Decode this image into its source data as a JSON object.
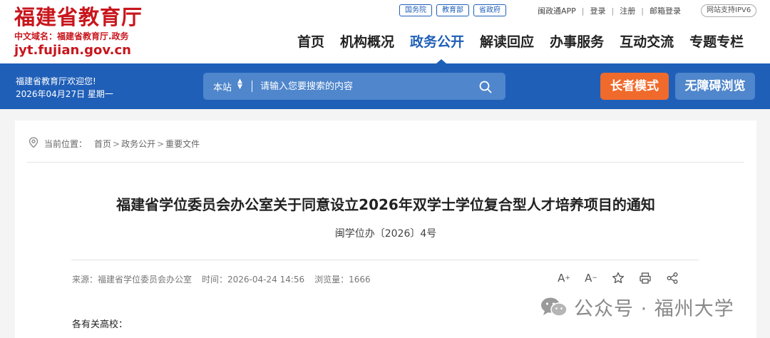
{
  "header": {
    "logo_title": "福建省教育厅",
    "logo_domain": "中文域名：福建省教育厅.政务",
    "logo_url": "jyt.fujian.gov.cn",
    "gov_links": [
      "国务院",
      "教育部",
      "省政府"
    ],
    "util_links": [
      "闽政通APP",
      "登录",
      "注册",
      "邮箱登录"
    ],
    "ipv6": "网站支持IPV6",
    "nav": [
      "首页",
      "机构概况",
      "政务公开",
      "解读回应",
      "办事服务",
      "互动交流",
      "专题专栏"
    ],
    "active_nav": "政务公开",
    "brand_color": "#c8161d",
    "accent_color": "#1f5fb8"
  },
  "bluebar": {
    "welcome": "福建省教育厅欢迎您!",
    "date": "2026年04月27日 星期一",
    "search_scope": "本站",
    "search_placeholder": "请输入您要搜索的内容",
    "elder_mode": "长者模式",
    "accessibility": "无障碍浏览",
    "elder_color": "#f06a2c"
  },
  "breadcrumb": {
    "label": "当前位置：",
    "items": [
      "首页",
      "政务公开",
      "重要文件"
    ]
  },
  "article": {
    "title": "福建省学位委员会办公室关于同意设立2026年双学士学位复合型人才培养项目的通知",
    "doc_number": "闽学位办〔2026〕4号",
    "source": "来源：福建省学位委员会办公室",
    "time": "时间：2026-04-24 14:56",
    "views": "浏览量：1666",
    "tools": [
      "font-increase-icon",
      "font-decrease-icon",
      "star-icon",
      "print-icon",
      "share-icon"
    ],
    "greeting": "各有关高校："
  },
  "watermark": {
    "text": "公众号 · 福州大学"
  }
}
